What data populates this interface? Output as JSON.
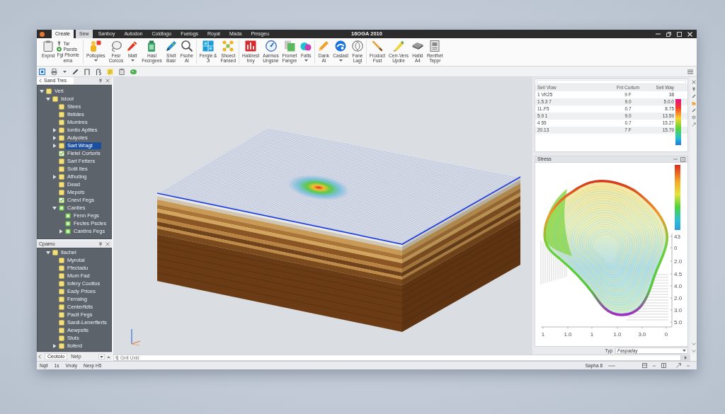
{
  "window": {
    "title": "16OGA 2010",
    "menu_tabs": [
      {
        "label": "Create",
        "selected": true,
        "hovered": false
      },
      {
        "label": "Sew",
        "selected": false,
        "hovered": true
      },
      {
        "label": "Sanboy",
        "selected": false,
        "hovered": false
      },
      {
        "label": "Autodon",
        "selected": false,
        "hovered": false
      },
      {
        "label": "Coldlogo",
        "selected": false,
        "hovered": false
      },
      {
        "label": "Fuelogs",
        "selected": false,
        "hovered": false
      },
      {
        "label": "Royal",
        "selected": false,
        "hovered": false
      },
      {
        "label": "Mada",
        "selected": false,
        "hovered": false
      },
      {
        "label": "Pmsgeu",
        "selected": false,
        "hovered": false
      }
    ]
  },
  "ribbon": {
    "groups": [
      {
        "items": [
          {
            "kind": "large",
            "lines": [
              "Expnd"
            ],
            "dropdown": false
          },
          {
            "kind": "stack",
            "entries": [
              "Tar",
              "Psests",
              "Fgi Pbonte",
              "ema"
            ]
          }
        ]
      },
      {
        "items": [
          {
            "kind": "large",
            "lines": [
              "Poltoples"
            ],
            "dropdown": true
          },
          {
            "kind": "large",
            "lines": [
              "Fesr",
              "Corcos"
            ],
            "dropdown": false
          },
          {
            "kind": "large",
            "lines": [
              "Matt"
            ],
            "dropdown": true
          },
          {
            "kind": "large",
            "lines": [
              "Hasl",
              "Fecngees"
            ],
            "dropdown": false
          },
          {
            "kind": "large",
            "lines": [
              "Shdt",
              "Basr"
            ],
            "dropdown": false
          },
          {
            "kind": "large",
            "lines": [
              "Fsohe",
              "Al"
            ],
            "dropdown": false
          }
        ]
      },
      {
        "items": [
          {
            "kind": "large",
            "lines": [
              "Fergle &",
              "Ji"
            ],
            "dropdown": false
          },
          {
            "kind": "large",
            "lines": [
              "Shoect",
              "Fansed"
            ],
            "dropdown": false
          }
        ]
      },
      {
        "items": [
          {
            "kind": "large",
            "lines": [
              "Haldrest",
              "trny"
            ],
            "dropdown": false
          },
          {
            "kind": "large",
            "lines": [
              "Aarmos",
              "Ungsne"
            ],
            "dropdown": false
          },
          {
            "kind": "large",
            "lines": [
              "Fromet",
              "Fangre"
            ],
            "dropdown": false
          },
          {
            "kind": "large",
            "lines": [
              "Fatts"
            ],
            "dropdown": true
          }
        ]
      },
      {
        "items": [
          {
            "kind": "large",
            "lines": [
              "Dank",
              "Al"
            ],
            "dropdown": false
          },
          {
            "kind": "large",
            "lines": [
              "Caslast"
            ],
            "dropdown": true
          },
          {
            "kind": "large",
            "lines": [
              "Fane",
              "Lagt"
            ],
            "dropdown": false
          }
        ]
      },
      {
        "items": [
          {
            "kind": "large",
            "lines": [
              "Frodoct",
              "Fust"
            ],
            "dropdown": false
          },
          {
            "kind": "large",
            "lines": [
              "Cerr-Vers",
              "Updre"
            ],
            "dropdown": false
          },
          {
            "kind": "large",
            "lines": [
              "Hatid",
              "A4"
            ],
            "dropdown": false
          },
          {
            "kind": "large",
            "lines": [
              "Renfhet",
              "Teppr"
            ],
            "dropdown": false
          }
        ]
      }
    ]
  },
  "left_panel": {
    "trees": [
      {
        "title": "Sand Tres",
        "items": [
          {
            "label": "Veit",
            "kind": "folder",
            "selected": false,
            "expanded": true,
            "children": [
              {
                "label": "Istool",
                "kind": "folder",
                "selected": false,
                "expanded": true,
                "children": [
                  {
                    "label": "Stees",
                    "kind": "folder",
                    "selected": false
                  },
                  {
                    "label": "Ifelides",
                    "kind": "folder",
                    "selected": false
                  },
                  {
                    "label": "Mumires",
                    "kind": "folder",
                    "selected": false
                  },
                  {
                    "label": "Iontlo Aptiles",
                    "kind": "folder",
                    "selected": false,
                    "expanded": false
                  },
                  {
                    "label": "Aulyotes",
                    "kind": "folder",
                    "selected": false,
                    "expanded": false
                  },
                  {
                    "label": "Sart Wragt",
                    "kind": "folder",
                    "selected": true,
                    "expanded": false
                  },
                  {
                    "label": "Fietel Cortorls",
                    "kind": "task",
                    "selected": false
                  },
                  {
                    "label": "Sart Fetters",
                    "kind": "folder",
                    "selected": false
                  },
                  {
                    "label": "Sotil Ites",
                    "kind": "folder",
                    "selected": false
                  },
                  {
                    "label": "Afhuting",
                    "kind": "folder",
                    "selected": false,
                    "expanded": false
                  },
                  {
                    "label": "Dead",
                    "kind": "folder",
                    "selected": false
                  },
                  {
                    "label": "Mepots",
                    "kind": "folder",
                    "selected": false
                  },
                  {
                    "label": "Cnevl Fegs",
                    "kind": "task",
                    "selected": false
                  },
                  {
                    "label": "Cantles",
                    "kind": "group",
                    "selected": false,
                    "expanded": true,
                    "children": [
                      {
                        "label": "Fenn Fegs",
                        "kind": "group",
                        "selected": false
                      },
                      {
                        "label": "Fecles Pscles",
                        "kind": "group",
                        "selected": false
                      },
                      {
                        "label": "Cantlns Fegs",
                        "kind": "group",
                        "selected": false,
                        "expanded": false
                      }
                    ]
                  }
                ]
              }
            ]
          }
        ]
      },
      {
        "title": "Cpamo",
        "items": [
          {
            "label": "Ilachel",
            "kind": "folder",
            "selected": false,
            "expanded": true,
            "children": [
              {
                "label": "Myrotal",
                "kind": "folder",
                "selected": false
              },
              {
                "label": "Ffectadu",
                "kind": "folder",
                "selected": false
              },
              {
                "label": "Mum Fad",
                "kind": "folder",
                "selected": false
              },
              {
                "label": "Iofery Cooltos",
                "kind": "folder",
                "selected": false
              },
              {
                "label": "Eady Prices",
                "kind": "folder",
                "selected": false
              },
              {
                "label": "Ferraing",
                "kind": "folder",
                "selected": false
              },
              {
                "label": "Centerfldts",
                "kind": "folder",
                "selected": false
              },
              {
                "label": "Pacit Fegs",
                "kind": "folder",
                "selected": false
              },
              {
                "label": "Sardi-Lenerfterts",
                "kind": "folder",
                "selected": false
              },
              {
                "label": "Aewpsits",
                "kind": "folder",
                "selected": false
              },
              {
                "label": "Sluts",
                "kind": "folder",
                "selected": false
              },
              {
                "label": "Iloferd",
                "kind": "folder",
                "selected": false,
                "expanded": false
              }
            ]
          }
        ]
      }
    ],
    "bottom_tabs": [
      {
        "label": "Ceotolo",
        "selected": true
      },
      {
        "label": "Nelp",
        "selected": false
      }
    ]
  },
  "command_field": {
    "placeholder": "Gnit Uxld"
  },
  "results_table": {
    "columns": [
      "Seil Vlow",
      "Fnt Curlum",
      "Seil Way"
    ],
    "rows": [
      [
        "1 VK25",
        "9 F",
        "38"
      ],
      [
        "1.5.3 7",
        "9.0",
        "5.0.0"
      ],
      [
        "1L.F5",
        "0.7",
        "8.75"
      ],
      [
        "5.9 1",
        "9.0",
        "13.59"
      ],
      [
        "4 55",
        "0.7",
        "15.27"
      ],
      [
        "20.13",
        "7 F",
        "15.79"
      ]
    ]
  },
  "stress_panel": {
    "title": "Stress",
    "x_tick_labels": [
      "1",
      "1.0",
      "1",
      "1.0",
      "3.0",
      "0"
    ],
    "y_tick_labels": [
      "43",
      "0",
      "2.0",
      "4.5",
      "4.0",
      "2.0",
      "3.0",
      "5.0"
    ]
  },
  "type_selector": {
    "label": "Typ",
    "value": "Faspaday"
  },
  "status_bar": {
    "left": [
      "Nqit",
      "1s",
      "Vnoty",
      "Nexp H5"
    ],
    "right": [
      "Sapha 8"
    ]
  }
}
